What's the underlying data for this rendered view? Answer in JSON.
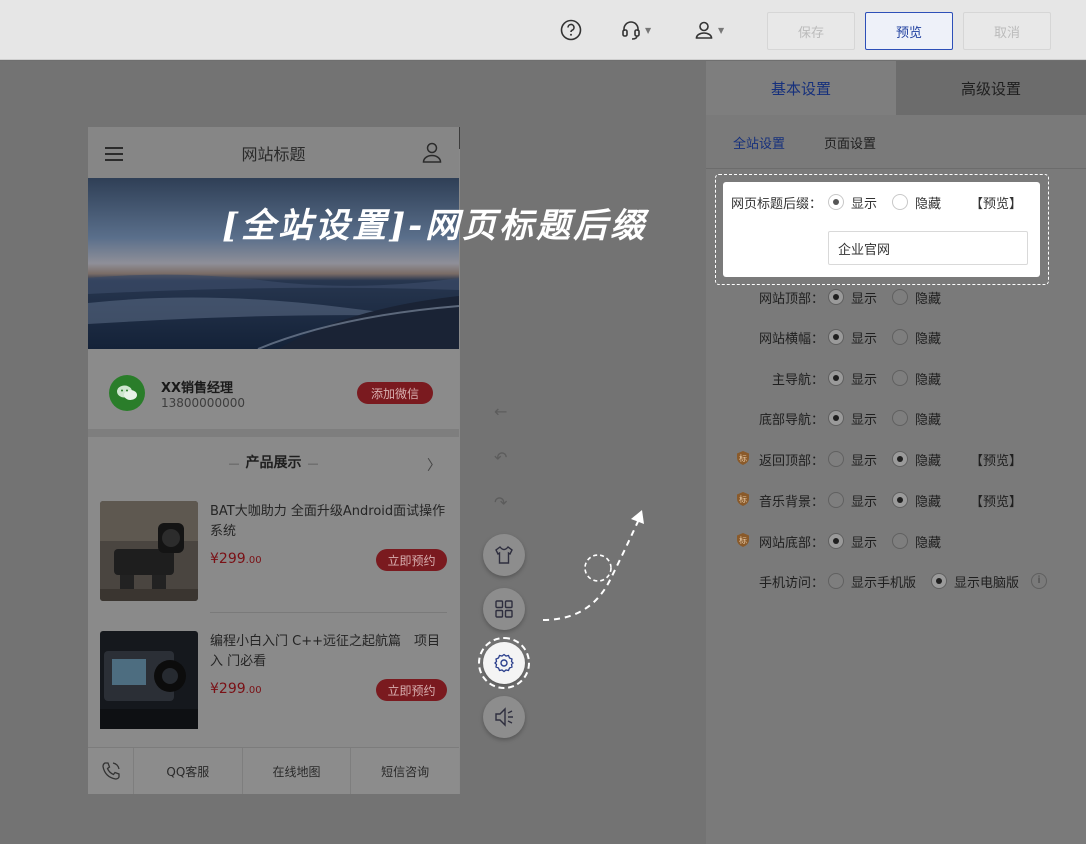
{
  "topbar": {
    "help_icon": "help-circle-icon",
    "support_icon": "headset-icon",
    "account_icon": "user-icon",
    "save_label": "保存",
    "preview_label": "预览",
    "cancel_label": "取消"
  },
  "phone": {
    "site_title": "网站标题",
    "contact": {
      "name": "XX销售经理",
      "phone": "13800000000",
      "add_wechat": "添加微信"
    },
    "section_title": "产品展示",
    "products": [
      {
        "title": "BAT大咖助力 全面升级Android面试操作系统",
        "price": "299",
        "price_decimal": ".00",
        "currency": "¥",
        "action": "立即预约"
      },
      {
        "title": "编程小白入门 C++远征之起航篇　项目入 门必看",
        "price": "299",
        "price_decimal": ".00",
        "currency": "¥",
        "action": "立即预约"
      }
    ],
    "footer": [
      "QQ客服",
      "在线地图",
      "短信咨询"
    ]
  },
  "annotation": {
    "text": "[全站设置]-网页标题后缀"
  },
  "panel": {
    "tabs": [
      "基本设置",
      "高级设置"
    ],
    "subtabs": [
      "全站设置",
      "页面设置"
    ],
    "highlight": {
      "label": "网页标题后缀：",
      "show": "显示",
      "hide": "隐藏",
      "preview": "【预览】",
      "input_value": "企业官网"
    },
    "rows": [
      {
        "label": "网站顶部：",
        "opt1": "显示",
        "opt2": "隐藏",
        "selected": 1
      },
      {
        "label": "网站横幅：",
        "opt1": "显示",
        "opt2": "隐藏",
        "selected": 1
      },
      {
        "label": "主导航：",
        "opt1": "显示",
        "opt2": "隐藏",
        "selected": 1
      },
      {
        "label": "底部导航：",
        "opt1": "显示",
        "opt2": "隐藏",
        "selected": 1
      },
      {
        "label": "返回顶部：",
        "opt1": "显示",
        "opt2": "隐藏",
        "selected": 2,
        "badge": true,
        "preview": "【预览】"
      },
      {
        "label": "音乐背景：",
        "opt1": "显示",
        "opt2": "隐藏",
        "selected": 2,
        "badge": true,
        "preview": "【预览】"
      },
      {
        "label": "网站底部：",
        "opt1": "显示",
        "opt2": "隐藏",
        "selected": 1,
        "badge": true
      },
      {
        "label": "手机访问：",
        "opt1": "显示手机版",
        "opt2": "显示电脑版",
        "selected": 2,
        "info": true
      }
    ]
  },
  "colors": {
    "accent": "#2d4fb8",
    "danger": "#c0282f",
    "overlay": "#737373"
  }
}
